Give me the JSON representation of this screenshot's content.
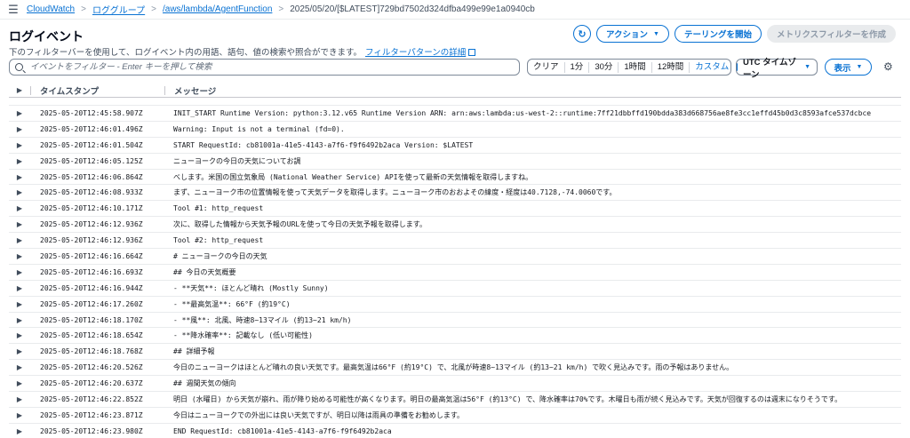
{
  "breadcrumb": {
    "items": [
      "CloudWatch",
      "ロググループ",
      "/aws/lambda/AgentFunction"
    ],
    "current": "2025/05/20/[$LATEST]729bd7502d324dfba499e99e1a0940cb",
    "separator": ">"
  },
  "header": {
    "title": "ログイベント",
    "subtitle": "下のフィルターバーを使用して、ログイベント内の用語、語句、値の検索や照合ができます。",
    "subtitle_link": "フィルターパターンの詳細",
    "refresh_icon": "↻",
    "actions_label": "アクション",
    "tail_label": "テーリングを開始",
    "metric_filter_label": "メトリクスフィルターを作成"
  },
  "filter": {
    "placeholder": "イベントをフィルター - Enter キーを押して検索",
    "ranges": [
      "クリア",
      "1分",
      "30分",
      "1時間",
      "12時間",
      "カスタム"
    ],
    "timezone": "UTC タイムゾーン",
    "view_label": "表示"
  },
  "table": {
    "columns": [
      "タイムスタンプ",
      "メッセージ"
    ],
    "partial_text": "...",
    "rows": [
      {
        "ts": "2025-05-20T12:45:58.907Z",
        "msg": "INIT_START Runtime Version: python:3.12.v65 Runtime Version ARN: arn:aws:lambda:us-west-2::runtime:7ff21dbbffd190bdda383d668756ae8fe3cc1effd45b0d3c8593afce537dcbce"
      },
      {
        "ts": "2025-05-20T12:46:01.496Z",
        "msg": "Warning: Input is not a terminal (fd=0)."
      },
      {
        "ts": "2025-05-20T12:46:01.504Z",
        "msg": "START RequestId: cb81001a-41e5-4143-a7f6-f9f6492b2aca Version: $LATEST"
      },
      {
        "ts": "2025-05-20T12:46:05.125Z",
        "msg": "ニューヨークの今日の天気についてお調"
      },
      {
        "ts": "2025-05-20T12:46:06.864Z",
        "msg": "べします。米国の国立気象局 (National Weather Service) APIを使って最新の天気情報を取得しますね。"
      },
      {
        "ts": "2025-05-20T12:46:08.933Z",
        "msg": "まず、ニューヨーク市の位置情報を使って天気データを取得します。ニューヨーク市のおおよその緯度・経度は40.7128,-74.0060です。"
      },
      {
        "ts": "2025-05-20T12:46:10.171Z",
        "msg": "Tool #1: http_request"
      },
      {
        "ts": "2025-05-20T12:46:12.936Z",
        "msg": "次に、取得した情報から天気予報のURLを使って今日の天気予報を取得します。"
      },
      {
        "ts": "2025-05-20T12:46:12.936Z",
        "msg": "Tool #2: http_request"
      },
      {
        "ts": "2025-05-20T12:46:16.664Z",
        "msg": "# ニューヨークの今日の天気"
      },
      {
        "ts": "2025-05-20T12:46:16.693Z",
        "msg": "## 今日の天気概要"
      },
      {
        "ts": "2025-05-20T12:46:16.944Z",
        "msg": "- **天気**: ほとんど晴れ (Mostly Sunny)"
      },
      {
        "ts": "2025-05-20T12:46:17.260Z",
        "msg": "- **最高気温**: 66°F (約19°C)"
      },
      {
        "ts": "2025-05-20T12:46:18.170Z",
        "msg": "- **風**: 北風、時速8~13マイル (約13~21 km/h)"
      },
      {
        "ts": "2025-05-20T12:46:18.654Z",
        "msg": "- **降水確率**: 記載なし (低い可能性)"
      },
      {
        "ts": "2025-05-20T12:46:18.768Z",
        "msg": "## 詳細予報"
      },
      {
        "ts": "2025-05-20T12:46:20.526Z",
        "msg": "今日のニューヨークはほとんど晴れの良い天気です。最高気温は66°F (約19°C) で、北風が時速8~13マイル (約13~21 km/h) で吹く見込みです。雨の予報はありません。"
      },
      {
        "ts": "2025-05-20T12:46:20.637Z",
        "msg": "## 週間天気の傾向"
      },
      {
        "ts": "2025-05-20T12:46:22.852Z",
        "msg": "明日 (水曜日) から天気が崩れ、雨が降り始める可能性が高くなります。明日の最高気温は56°F (約13°C) で、降水確率は70%です。木曜日も雨が続く見込みです。天気が回復するのは週末になりそうです。"
      },
      {
        "ts": "2025-05-20T12:46:23.871Z",
        "msg": "今日はニューヨークでの外出には良い天気ですが、明日以降は雨具の準備をお勧めします。"
      },
      {
        "ts": "2025-05-20T12:46:23.980Z",
        "msg": "END RequestId: cb81001a-41e5-4143-a7f6-f9f6492b2aca"
      }
    ]
  }
}
